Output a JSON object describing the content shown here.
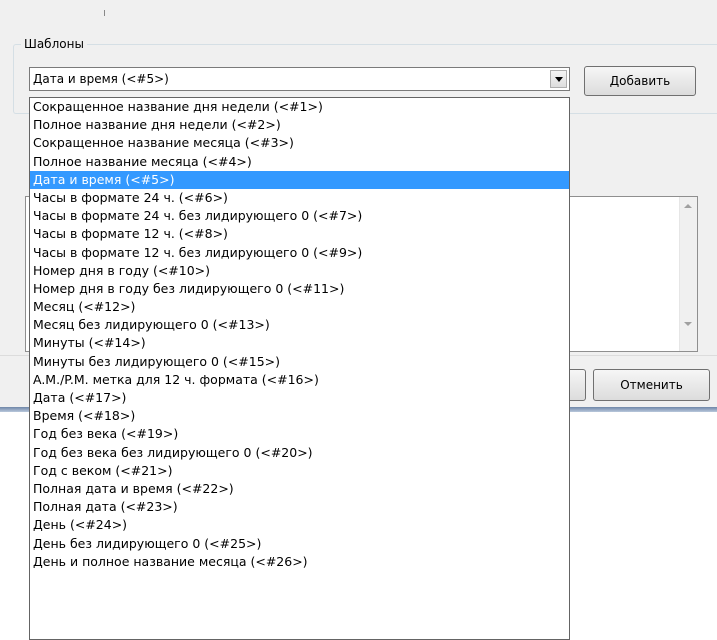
{
  "templates_group": {
    "legend": "Шаблоны",
    "combo_value": "Дата и время (<#5>)",
    "add_button": "Добавить"
  },
  "dialog_buttons": {
    "cancel": "Отменить"
  },
  "icons": {
    "combo_arrow": "chevron-down-icon",
    "scroll_up": "scroll-up-arrow-icon",
    "scroll_down": "scroll-down-arrow-icon"
  },
  "colors": {
    "selection": "#3399ff",
    "dialog_bg": "#f0f0f0"
  },
  "dropdown": {
    "selected_index": 4,
    "items": [
      "Сокращенное название дня недели (<#1>)",
      "Полное название дня недели (<#2>)",
      "Сокращенное название месяца (<#3>)",
      "Полное название месяца (<#4>)",
      "Дата и время (<#5>)",
      "Часы в формате 24 ч. (<#6>)",
      "Часы в формате 24 ч. без лидирующего 0 (<#7>)",
      "Часы в формате 12 ч. (<#8>)",
      "Часы в формате 12 ч. без лидирующего 0 (<#9>)",
      "Номер дня в году (<#10>)",
      "Номер дня в году без лидирующего 0 (<#11>)",
      "Месяц (<#12>)",
      "Месяц без лидирующего 0 (<#13>)",
      "Минуты (<#14>)",
      "Минуты без лидирующего 0 (<#15>)",
      "A.M./P.M. метка для 12 ч. формата (<#16>)",
      "Дата (<#17>)",
      "Время (<#18>)",
      "Год без века (<#19>)",
      "Год без века без лидирующего 0 (<#20>)",
      "Год с веком (<#21>)",
      "Полная дата и время (<#22>)",
      "Полная дата (<#23>)",
      "День (<#24>)",
      "День без лидирующего 0 (<#25>)",
      "День и полное название месяца (<#26>)"
    ]
  }
}
